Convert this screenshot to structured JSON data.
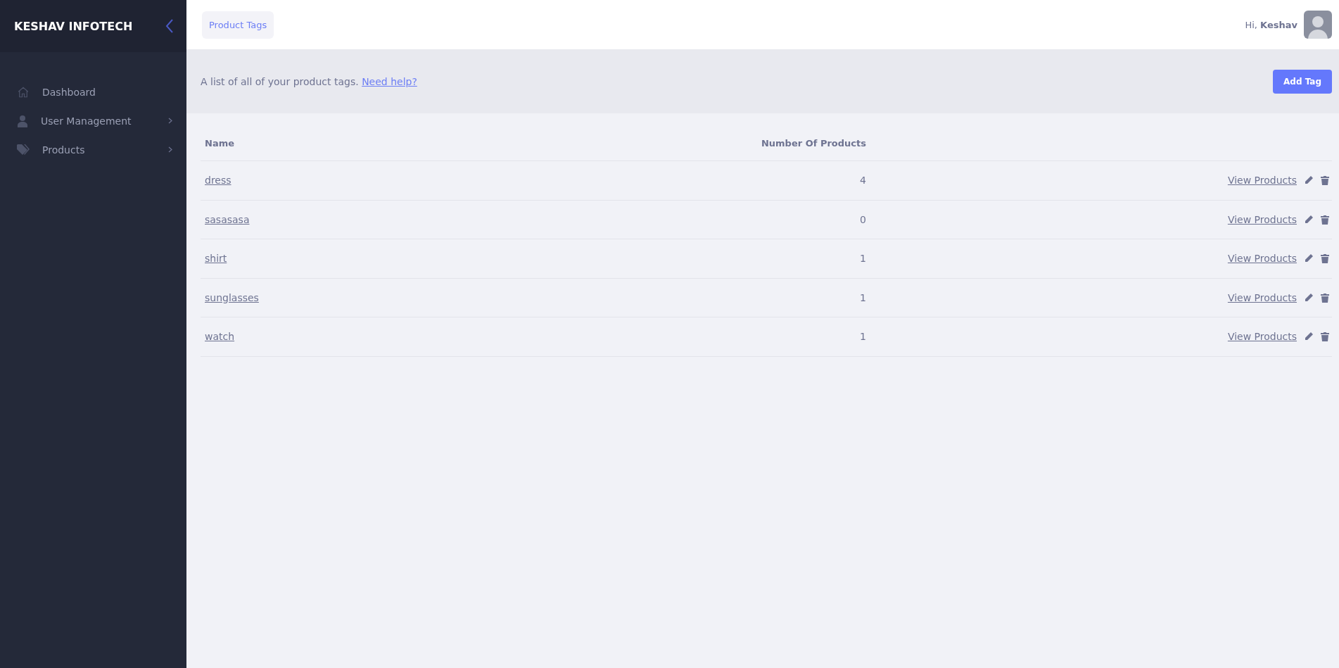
{
  "sidebar": {
    "brand": "KESHAV INFOTECH",
    "items": [
      {
        "label": "Dashboard",
        "kind": "home",
        "has_submenu": false
      },
      {
        "label": "User Management",
        "kind": "user",
        "has_submenu": true
      },
      {
        "label": "Products",
        "kind": "tag",
        "has_submenu": true
      }
    ]
  },
  "header": {
    "breadcrumb": "Product Tags",
    "greeting": "Hi,",
    "user_name": "Keshav"
  },
  "info_bar": {
    "text": "A list of all of your product tags.",
    "link": "Need help?",
    "button": "Add Tag"
  },
  "table": {
    "columns": [
      "Name",
      "Number Of Products"
    ],
    "rows": [
      {
        "name": "dress",
        "count": "4",
        "action": "View Products"
      },
      {
        "name": "sasasasa",
        "count": "0",
        "action": "View Products"
      },
      {
        "name": "shirt",
        "count": "1",
        "action": "View Products"
      },
      {
        "name": "sunglasses",
        "count": "1",
        "action": "View Products"
      },
      {
        "name": "watch",
        "count": "1",
        "action": "View Products"
      }
    ]
  }
}
